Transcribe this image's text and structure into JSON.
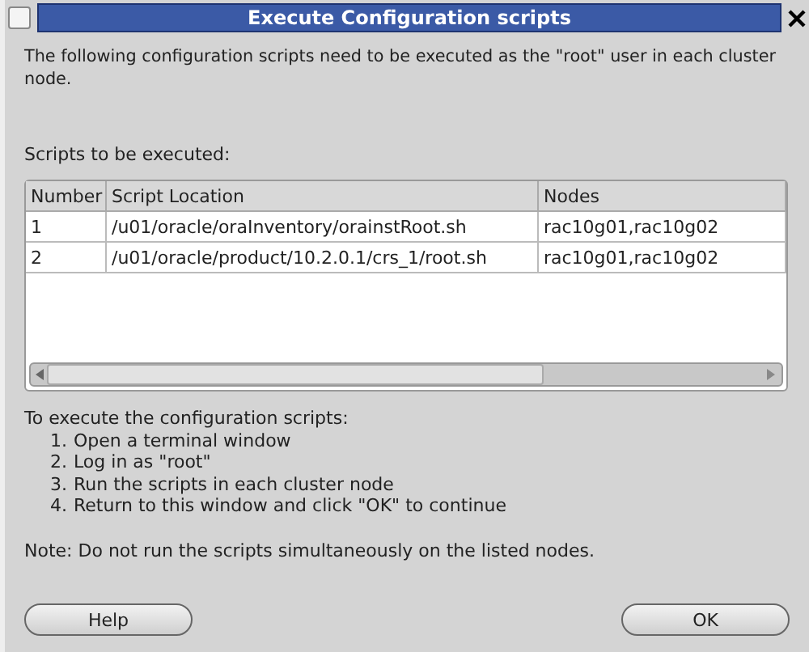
{
  "window": {
    "title": "Execute Configuration scripts"
  },
  "intro": "The following configuration scripts need to be executed as the \"root\" user in each cluster node.",
  "table_label": "Scripts to be executed:",
  "table": {
    "columns": [
      "Number",
      "Script Location",
      "Nodes"
    ],
    "rows": [
      [
        "1",
        "/u01/oracle/oraInventory/orainstRoot.sh",
        "rac10g01,rac10g02"
      ],
      [
        "2",
        "/u01/oracle/product/10.2.0.1/crs_1/root.sh",
        "rac10g01,rac10g02"
      ]
    ]
  },
  "instructions_heading": "To execute the configuration scripts:",
  "steps": [
    {
      "number": "1.",
      "text": "Open a terminal window"
    },
    {
      "number": "2.",
      "text": "Log in as \"root\""
    },
    {
      "number": "3.",
      "text": "Run the scripts in each cluster node"
    },
    {
      "number": "4.",
      "text": "Return to this window and click \"OK\" to continue"
    }
  ],
  "note": "Note: Do not run the scripts simultaneously on the listed nodes.",
  "buttons": [
    "Help",
    "OK"
  ]
}
